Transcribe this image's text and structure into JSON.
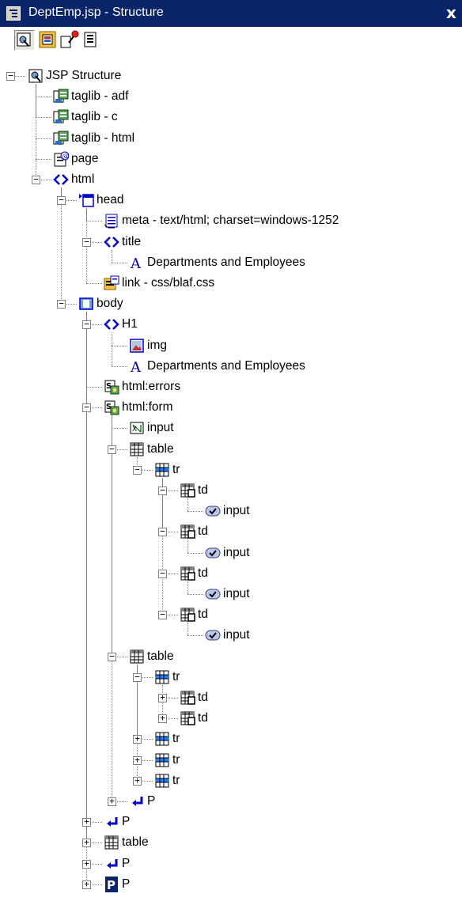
{
  "window": {
    "title": "DeptEmp.jsp - Structure",
    "close_glyph": "x"
  },
  "toolbar": {
    "buttons": [
      {
        "name": "structure-view-button",
        "icon": "jsp-structure-icon"
      },
      {
        "name": "properties-button",
        "icon": "properties-icon"
      },
      {
        "name": "flag-button",
        "icon": "red-flag-icon"
      },
      {
        "name": "source-button",
        "icon": "document-icon"
      }
    ]
  },
  "tree": {
    "nodes": [
      {
        "depth": 0,
        "label": "JSP Structure",
        "icon": "jsp-structure-icon",
        "expander": "minus"
      },
      {
        "depth": 1,
        "label": "taglib - adf",
        "icon": "taglib-icon",
        "expander": null
      },
      {
        "depth": 1,
        "label": "taglib - c",
        "icon": "taglib-icon",
        "expander": null
      },
      {
        "depth": 1,
        "label": "taglib - html",
        "icon": "taglib-icon",
        "expander": null
      },
      {
        "depth": 1,
        "label": "page",
        "icon": "page-directive-icon",
        "expander": null
      },
      {
        "depth": 1,
        "label": "html",
        "icon": "tag-brackets-icon",
        "expander": "minus"
      },
      {
        "depth": 2,
        "label": "head",
        "icon": "head-icon",
        "expander": "minus"
      },
      {
        "depth": 3,
        "label": "meta - text/html; charset=windows-1252",
        "icon": "meta-icon",
        "expander": null
      },
      {
        "depth": 3,
        "label": "title",
        "icon": "tag-brackets-icon",
        "expander": "minus"
      },
      {
        "depth": 4,
        "label": "Departments and Employees",
        "icon": "text-icon",
        "expander": null
      },
      {
        "depth": 3,
        "label": "link - css/blaf.css",
        "icon": "link-icon",
        "expander": null
      },
      {
        "depth": 2,
        "label": "body",
        "icon": "body-icon",
        "expander": "minus"
      },
      {
        "depth": 3,
        "label": "H1",
        "icon": "tag-brackets-icon",
        "expander": "minus"
      },
      {
        "depth": 4,
        "label": "img",
        "icon": "image-icon",
        "expander": null
      },
      {
        "depth": 4,
        "label": "Departments and Employees",
        "icon": "text-icon",
        "expander": null
      },
      {
        "depth": 3,
        "label": "html:errors",
        "icon": "struts-tag-icon",
        "expander": null
      },
      {
        "depth": 3,
        "label": "html:form",
        "icon": "struts-tag-icon",
        "expander": "minus"
      },
      {
        "depth": 4,
        "label": "input",
        "icon": "input-tag-icon",
        "expander": null
      },
      {
        "depth": 4,
        "label": "table",
        "icon": "table-icon",
        "expander": "minus"
      },
      {
        "depth": 5,
        "label": "tr",
        "icon": "table-row-icon",
        "expander": "minus"
      },
      {
        "depth": 6,
        "label": "td",
        "icon": "table-cell-icon",
        "expander": "minus"
      },
      {
        "depth": 7,
        "label": "input",
        "icon": "input-field-icon",
        "expander": null
      },
      {
        "depth": 6,
        "label": "td",
        "icon": "table-cell-icon",
        "expander": "minus"
      },
      {
        "depth": 7,
        "label": "input",
        "icon": "input-field-icon",
        "expander": null
      },
      {
        "depth": 6,
        "label": "td",
        "icon": "table-cell-icon",
        "expander": "minus"
      },
      {
        "depth": 7,
        "label": "input",
        "icon": "input-field-icon",
        "expander": null
      },
      {
        "depth": 6,
        "label": "td",
        "icon": "table-cell-icon",
        "expander": "minus"
      },
      {
        "depth": 7,
        "label": "input",
        "icon": "input-field-icon",
        "expander": null
      },
      {
        "depth": 4,
        "label": "table",
        "icon": "table-icon",
        "expander": "minus"
      },
      {
        "depth": 5,
        "label": "tr",
        "icon": "table-row-icon",
        "expander": "minus"
      },
      {
        "depth": 6,
        "label": "td",
        "icon": "table-cell-icon",
        "expander": "plus"
      },
      {
        "depth": 6,
        "label": "td",
        "icon": "table-cell-icon",
        "expander": "plus"
      },
      {
        "depth": 5,
        "label": "tr",
        "icon": "table-row-icon",
        "expander": "plus"
      },
      {
        "depth": 5,
        "label": "tr",
        "icon": "table-row-icon",
        "expander": "plus"
      },
      {
        "depth": 5,
        "label": "tr",
        "icon": "table-row-icon",
        "expander": "plus"
      },
      {
        "depth": 4,
        "label": "P",
        "icon": "paragraph-icon",
        "expander": "plus"
      },
      {
        "depth": 3,
        "label": "P",
        "icon": "paragraph-icon",
        "expander": "plus"
      },
      {
        "depth": 3,
        "label": "table",
        "icon": "table-icon",
        "expander": "plus"
      },
      {
        "depth": 3,
        "label": "P",
        "icon": "paragraph-icon",
        "expander": "plus"
      },
      {
        "depth": 3,
        "label": "P",
        "icon": "paragraph-icon",
        "expander": "plus",
        "selected": true
      }
    ]
  },
  "colors": {
    "titlebar": "#0a246a",
    "tag_blue": "#0000cc",
    "taglib_green": "#208020",
    "selection": "#0a246a"
  }
}
